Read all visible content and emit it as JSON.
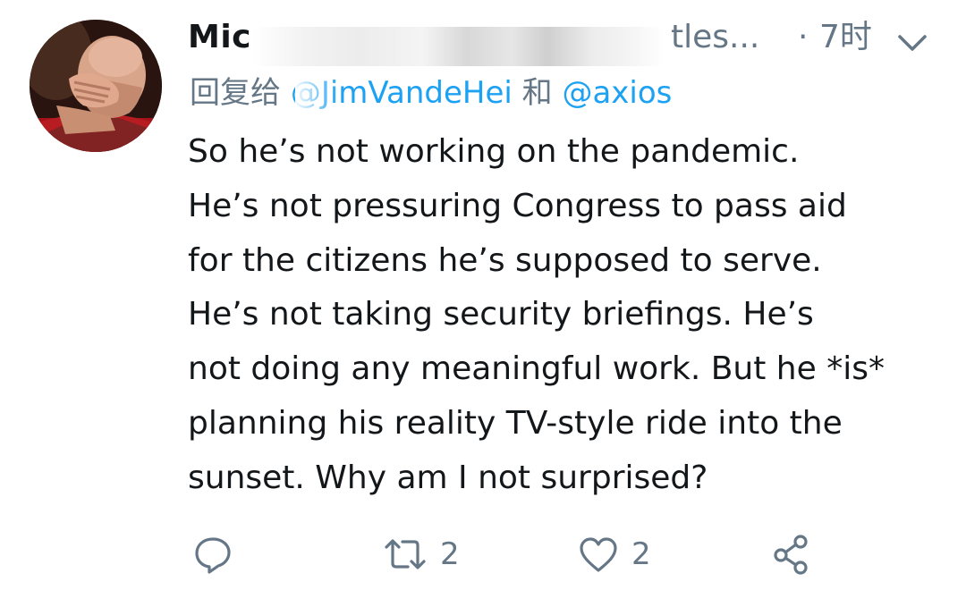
{
  "tweet": {
    "display_name_visible": "Mic",
    "handle_tail": "tles...",
    "separator": "·",
    "timestamp": "7时",
    "menu_icon": "chevron-down-icon",
    "reply_prefix": "回复给",
    "reply_user_1": "@JimVandeHei",
    "reply_joiner": "和",
    "reply_user_2": "@axios",
    "text": "So he’s not working on the pandemic.\nHe’s not pressuring Congress to pass aid\nfor the citizens he’s supposed to serve.\nHe’s not taking security briefings. He’s\nnot doing any meaningful work. But he *is*\nplanning his reality TV-style ride into the\nsunset. Why am I not surprised?",
    "actions": {
      "reply_icon": "comment-bubble-icon",
      "retweet_icon": "retweet-icon",
      "retweet_count": "2",
      "like_icon": "heart-icon",
      "like_count": "2",
      "share_icon": "share-icon"
    }
  },
  "colors": {
    "text_primary": "#14171a",
    "text_secondary": "#657786",
    "link": "#1da1f2",
    "background": "#ffffff"
  }
}
